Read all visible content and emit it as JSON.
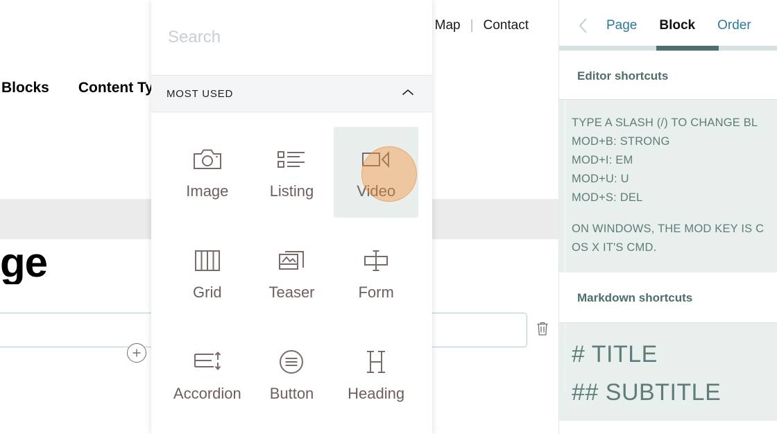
{
  "background": {
    "nav_links": [
      {
        "label": "ite Map"
      },
      {
        "label": "Contact"
      }
    ],
    "nav_separator": "|",
    "section_tabs": [
      {
        "label": "Blocks"
      },
      {
        "label": "Content Ty"
      }
    ],
    "document_heading": "ge",
    "delete_icon": "trash-icon",
    "add_block_icon": "plus-circle-icon"
  },
  "block_chooser": {
    "search": {
      "value": "",
      "placeholder": "Search"
    },
    "group": {
      "label": "MOST USED",
      "collapse_icon": "chevron-up-icon",
      "expanded": true
    },
    "blocks": [
      {
        "label": "Image",
        "icon": "camera-icon",
        "hovered": false
      },
      {
        "label": "Listing",
        "icon": "list-icon",
        "hovered": false
      },
      {
        "label": "Video",
        "icon": "video-icon",
        "hovered": true
      },
      {
        "label": "Grid",
        "icon": "columns-icon",
        "hovered": false
      },
      {
        "label": "Teaser",
        "icon": "cards-icon",
        "hovered": false
      },
      {
        "label": "Form",
        "icon": "form-field-icon",
        "hovered": false
      },
      {
        "label": "Accordion",
        "icon": "accordion-icon",
        "hovered": false
      },
      {
        "label": "Button",
        "icon": "button-icon",
        "hovered": false
      },
      {
        "label": "Heading",
        "icon": "heading-h-icon",
        "hovered": false
      }
    ],
    "click_indicator": {
      "color": "#F39237",
      "target": "Video"
    }
  },
  "sidebar": {
    "back_icon": "chevron-left-icon",
    "tabs": [
      {
        "label": "Page",
        "active": false
      },
      {
        "label": "Block",
        "active": true
      },
      {
        "label": "Order",
        "active": false
      }
    ],
    "accent_color": "#4F6F6F",
    "editor_shortcuts": {
      "title": "Editor shortcuts",
      "lines": [
        "TYPE A SLASH (/) TO CHANGE BL",
        "MOD+B: STRONG",
        "MOD+I: EM",
        "MOD+U: U",
        "MOD+S: DEL"
      ],
      "note_lines": [
        "ON WINDOWS, THE MOD KEY IS C",
        "OS X IT'S CMD."
      ]
    },
    "markdown_shortcuts": {
      "title": "Markdown shortcuts",
      "lines": [
        "# TITLE",
        "## SUBTITLE"
      ]
    }
  }
}
